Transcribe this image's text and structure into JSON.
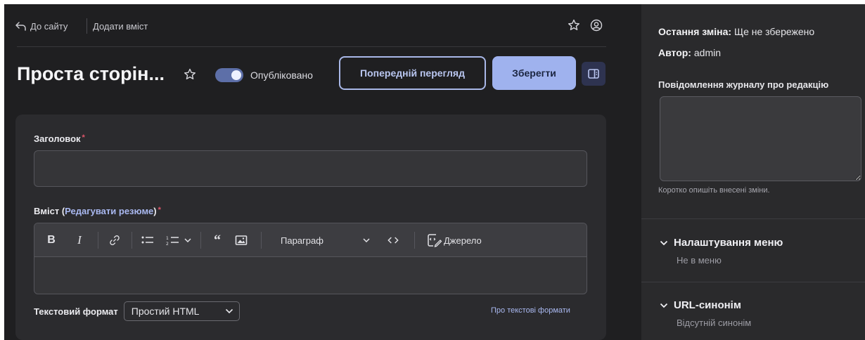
{
  "header": {
    "back_label": "До сайту",
    "breadcrumb": "Додати вміст",
    "icons": [
      "back-arrow-icon",
      "star-icon",
      "user-icon"
    ]
  },
  "title_bar": {
    "page_title": "Проста сторін...",
    "published_label": "Опубліковано",
    "published_on": true,
    "preview_label": "Попередній перегляд",
    "save_label": "Зберегти",
    "accent": "#9fb2ee"
  },
  "form": {
    "title_label": "Заголовок",
    "title_value": "",
    "required_marker": "*",
    "body_label_prefix": "Вміст (",
    "body_link": "Редагувати резюме",
    "body_label_suffix": ")",
    "toolbar": {
      "paragraph_label": "Параграф",
      "source_label": "Джерело",
      "icons": [
        "bold-icon",
        "italic-icon",
        "link-icon",
        "bulleted-list-icon",
        "numbered-list-icon",
        "blockquote-icon",
        "image-icon",
        "code-icon",
        "source-icon"
      ]
    },
    "text_format_label": "Текстовий формат",
    "text_format_value": "Простий HTML",
    "text_format_help": "Про текстові формати"
  },
  "sidebar": {
    "last_change_label": "Остання зміна:",
    "last_change_value": "Ще не збережено",
    "author_label": "Автор:",
    "author_value": "admin",
    "revision_log_label": "Повідомлення журналу про редакцію",
    "revision_log_value": "",
    "revision_hint": "Коротко опишіть внесені зміни.",
    "menu_settings_label": "Налаштування меню",
    "menu_settings_value": "Не в меню",
    "url_alias_label": "URL-синонім",
    "url_alias_value": "Відсутній синонім"
  }
}
